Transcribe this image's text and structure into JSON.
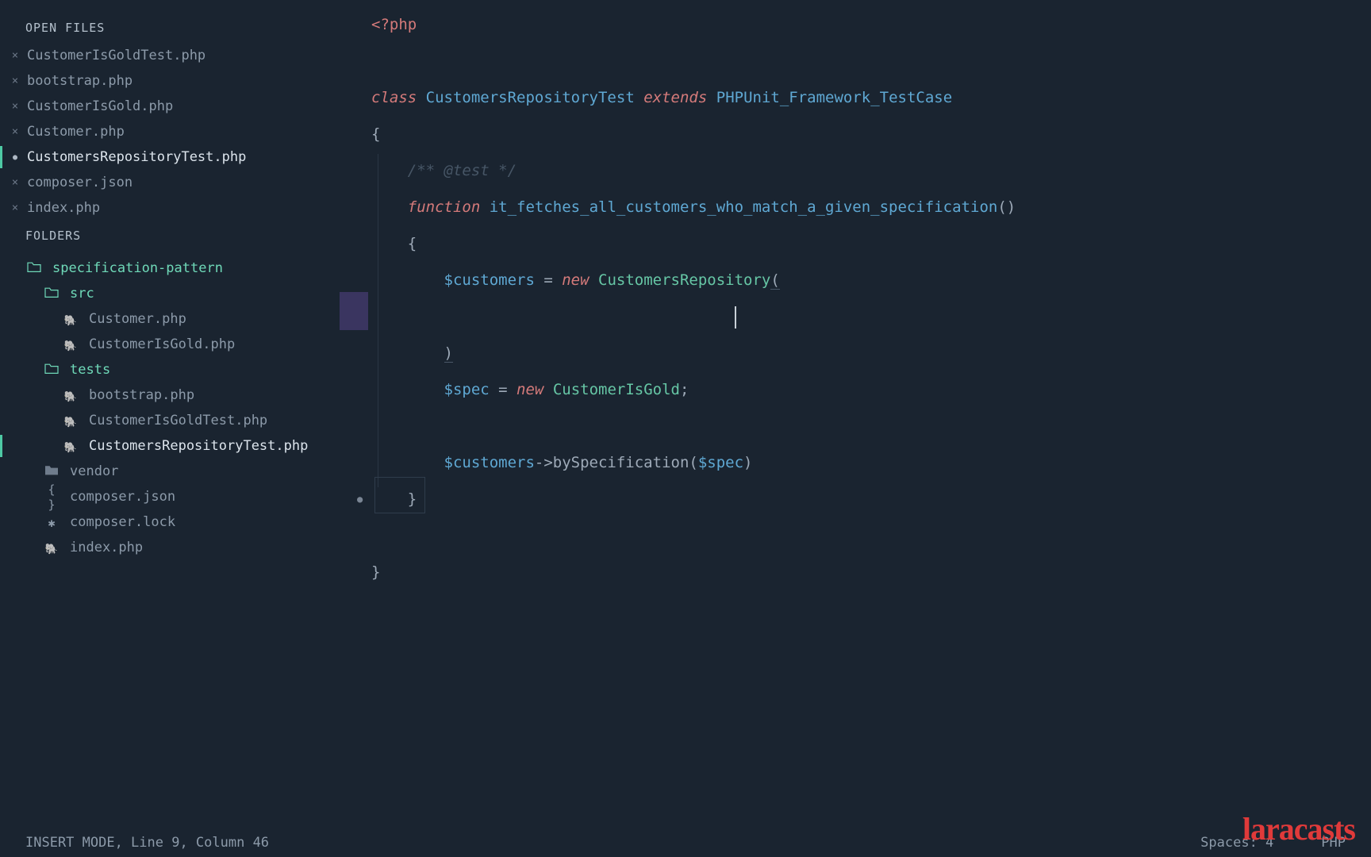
{
  "sidebar": {
    "open_files_title": "OPEN FILES",
    "folders_title": "FOLDERS",
    "open_files": [
      {
        "name": "CustomerIsGoldTest.php",
        "modified": false,
        "active": false
      },
      {
        "name": "bootstrap.php",
        "modified": false,
        "active": false
      },
      {
        "name": "CustomerIsGold.php",
        "modified": false,
        "active": false
      },
      {
        "name": "Customer.php",
        "modified": false,
        "active": false
      },
      {
        "name": "CustomersRepositoryTest.php",
        "modified": true,
        "active": true
      },
      {
        "name": "composer.json",
        "modified": false,
        "active": false
      },
      {
        "name": "index.php",
        "modified": false,
        "active": false
      }
    ],
    "tree": [
      {
        "type": "folder-open",
        "depth": 0,
        "label": "specification-pattern",
        "accent": true
      },
      {
        "type": "folder-open",
        "depth": 1,
        "label": "src",
        "accent": true
      },
      {
        "type": "file-php",
        "depth": 2,
        "label": "Customer.php"
      },
      {
        "type": "file-php",
        "depth": 2,
        "label": "CustomerIsGold.php"
      },
      {
        "type": "folder-open",
        "depth": 1,
        "label": "tests",
        "accent": true
      },
      {
        "type": "file-php",
        "depth": 2,
        "label": "bootstrap.php"
      },
      {
        "type": "file-php",
        "depth": 2,
        "label": "CustomerIsGoldTest.php"
      },
      {
        "type": "file-php",
        "depth": 2,
        "label": "CustomersRepositoryTest.php",
        "active": true
      },
      {
        "type": "folder-closed",
        "depth": 1,
        "label": "vendor"
      },
      {
        "type": "file-json",
        "depth": 1,
        "label": "composer.json"
      },
      {
        "type": "file-lock",
        "depth": 1,
        "label": "composer.lock"
      },
      {
        "type": "file-php",
        "depth": 1,
        "label": "index.php"
      }
    ]
  },
  "code": {
    "open_tag": "<?php",
    "kw_class": "class",
    "class_name": "CustomersRepositoryTest",
    "kw_extends": "extends",
    "base_class": "PHPUnit_Framework_TestCase",
    "open_brace": "{",
    "doc": "/** @test */",
    "kw_function": "function",
    "fn_name": "it_fetches_all_customers_who_match_a_given_specification",
    "parens": "()",
    "open_brace2": "{",
    "var_customers": "$customers",
    "eq": " = ",
    "kw_new": "new",
    "class_repo": "CustomersRepository",
    "open_paren": "(",
    "close_paren": ")",
    "var_spec": "$spec",
    "class_spec": "CustomerIsGold",
    "semi": ";",
    "arrow": "->",
    "method_by": "bySpecification",
    "open_p2": "(",
    "close_p2": ")",
    "close_brace2": "}",
    "close_brace": "}"
  },
  "status": {
    "left": "INSERT MODE, Line 9, Column 46",
    "spaces": "Spaces: 4",
    "lang": "PHP"
  },
  "brand": "laracasts"
}
